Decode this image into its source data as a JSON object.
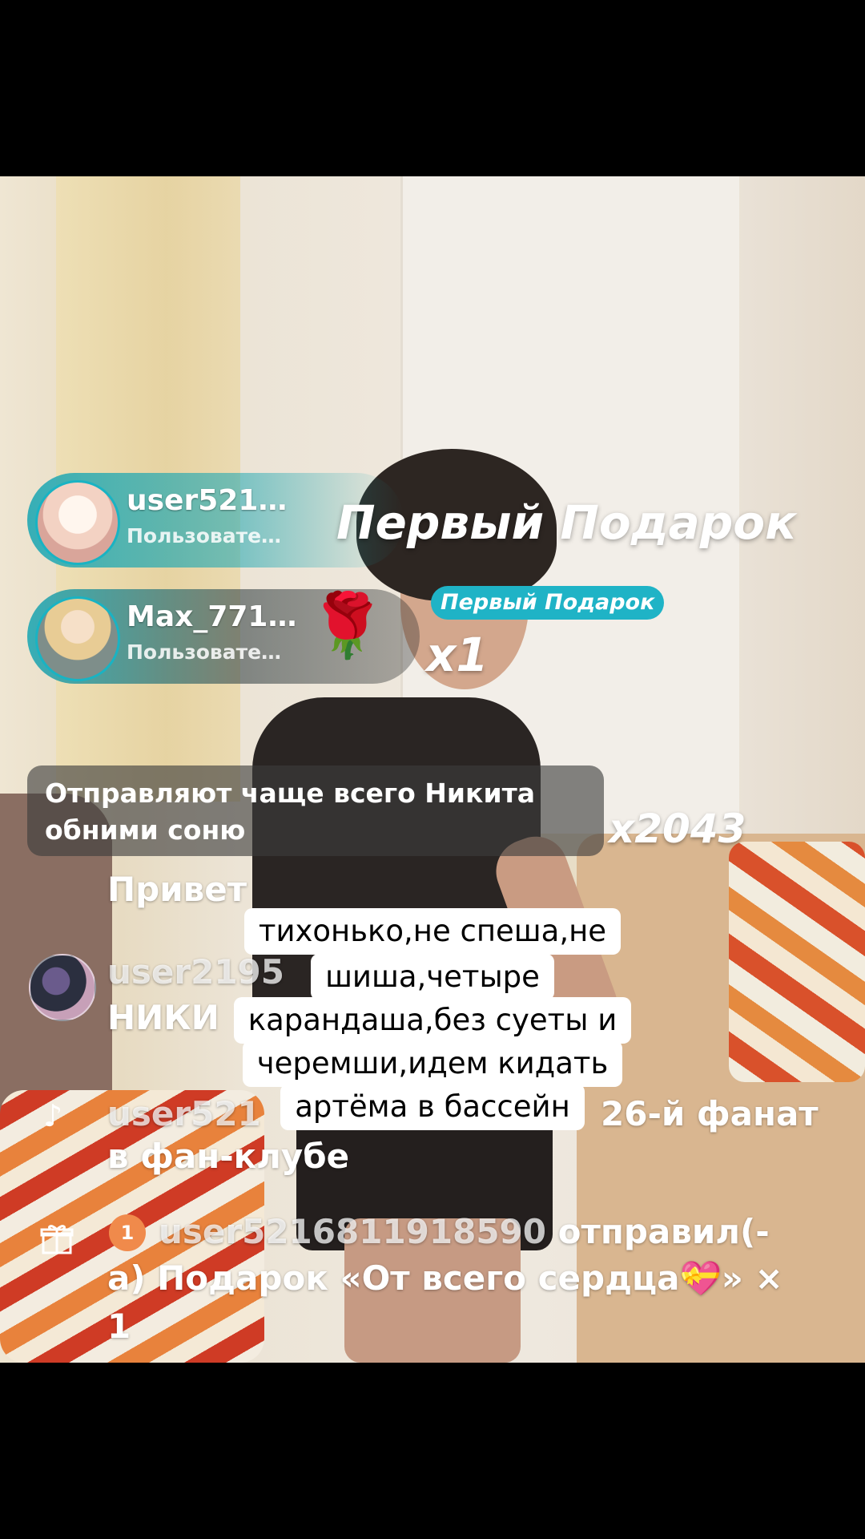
{
  "gift_notifications": [
    {
      "username": "user521…",
      "subtitle": "Пользовате…",
      "gift_title": "Первый Подарок"
    },
    {
      "username": "Max_771…",
      "subtitle": "Пользовате…",
      "gift_icon": "rose-icon",
      "badge": "Первый Подарок",
      "multiplier": "x1"
    }
  ],
  "frequent_gifts": {
    "text": "Отправляют чаще всего Никита обними соню",
    "multiplier": "x2043"
  },
  "chat": {
    "msg1": "Привет",
    "msg2_user": "user2195",
    "msg2_text": "НИКИ",
    "msg3_user": "user521",
    "msg3_suffix": "26-й фанат",
    "msg3_line2": "в фан-клубе",
    "gift_user": "user5216811918590",
    "gift_action": " отправил(-",
    "gift_line2": "а) Подарок «От всего сердца",
    "gift_line2_end": "» ×",
    "gift_line3": "1",
    "heart_badge": "1"
  },
  "caption": {
    "lines": [
      "тихонько,не спеша,не",
      "шиша,четыре",
      "карандаша,без суеты и",
      "черемши,идем кидать",
      "артёма в бассейн"
    ]
  },
  "colors": {
    "accent": "#1fb3c6",
    "heart": "#f08a4b"
  }
}
